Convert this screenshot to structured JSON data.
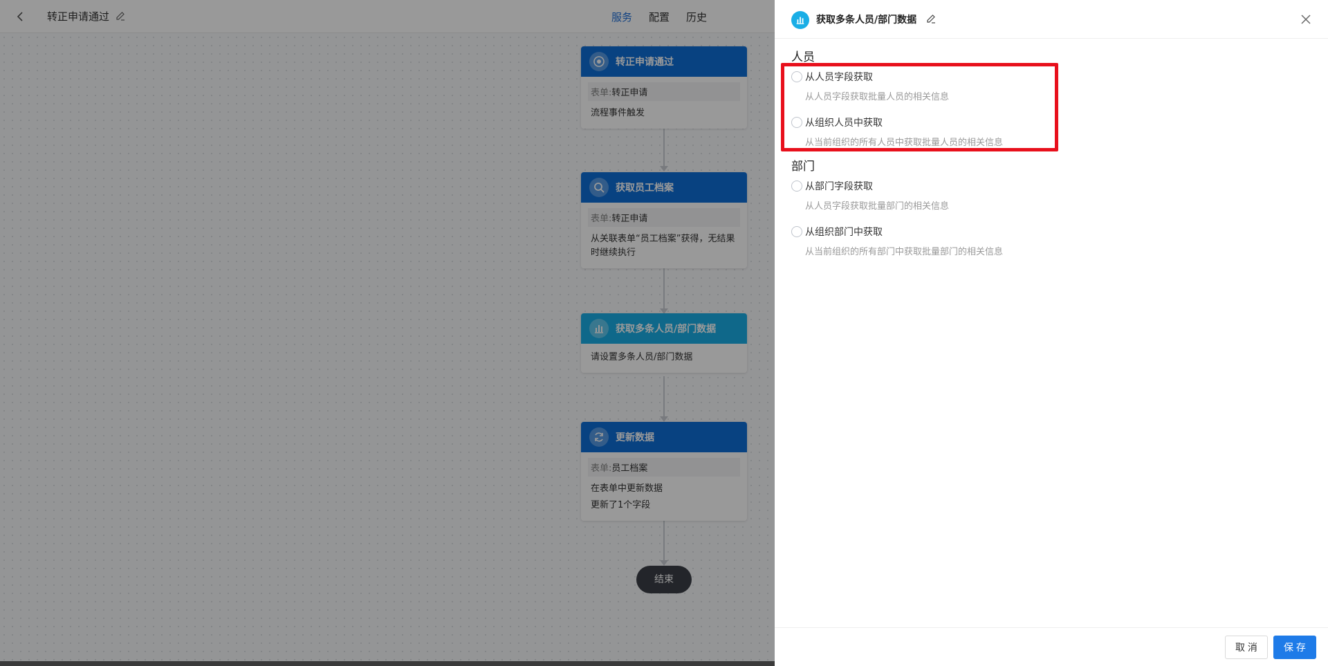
{
  "topbar": {
    "title": "转正申请通过",
    "tabs": [
      {
        "label": "服务",
        "active": true
      },
      {
        "label": "配置",
        "active": false
      },
      {
        "label": "历史",
        "active": false
      }
    ]
  },
  "flow": {
    "nodes": [
      {
        "title": "转正申请通过",
        "icon": "target-icon",
        "form_label": "表单:",
        "form_value": "转正申请",
        "lines": [
          "流程事件触发"
        ]
      },
      {
        "title": "获取员工档案",
        "icon": "search-icon",
        "form_label": "表单:",
        "form_value": "转正申请",
        "lines": [
          "从关联表单“员工档案”获得，无结果",
          "时继续执行"
        ]
      },
      {
        "title": "获取多条人员/部门数据",
        "icon": "bar-chart-icon",
        "lines": [
          "请设置多条人员/部门数据"
        ]
      },
      {
        "title": "更新数据",
        "icon": "refresh-icon",
        "form_label": "表单:",
        "form_value": "员工档案",
        "lines": [
          "在表单中更新数据",
          "更新了1个字段"
        ]
      }
    ],
    "end_label": "结束"
  },
  "drawer": {
    "title": "获取多条人员/部门数据",
    "sections": [
      {
        "title": "人员",
        "options": [
          {
            "label": "从人员字段获取",
            "desc": "从人员字段获取批量人员的相关信息"
          },
          {
            "label": "从组织人员中获取",
            "desc": "从当前组织的所有人员中获取批量人员的相关信息"
          }
        ]
      },
      {
        "title": "部门",
        "options": [
          {
            "label": "从部门字段获取",
            "desc": "从人员字段获取批量部门的相关信息"
          },
          {
            "label": "从组织部门中获取",
            "desc": "从当前组织的所有部门中获取批量部门的相关信息"
          }
        ]
      }
    ],
    "cancel_label": "取 消",
    "save_label": "保 存"
  },
  "colors": {
    "primary": "#0e6fd8",
    "cyan": "#1aaee6",
    "highlight": "#e8101c"
  }
}
